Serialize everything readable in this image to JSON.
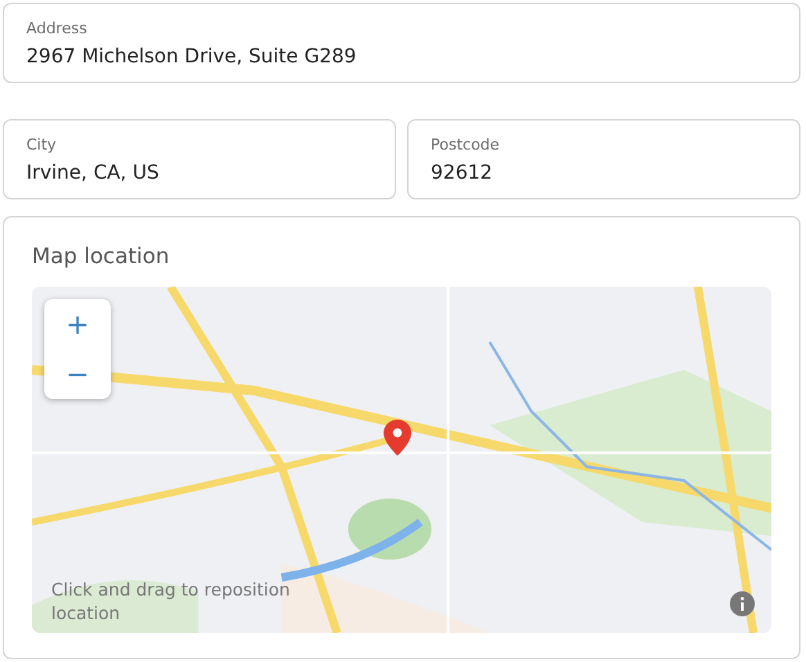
{
  "field_rows": [
    [
      {
        "label": "Address",
        "value": "2967 Michelson Drive, Suite G289"
      }
    ],
    [
      {
        "label": "City",
        "value": "Irvine, CA, US"
      },
      {
        "label": "Postcode",
        "value": "92612"
      }
    ]
  ],
  "map_card": {
    "title": "Map location",
    "zoom_in": "+",
    "zoom_out": "−",
    "hint": "Click and drag to reposition location"
  }
}
